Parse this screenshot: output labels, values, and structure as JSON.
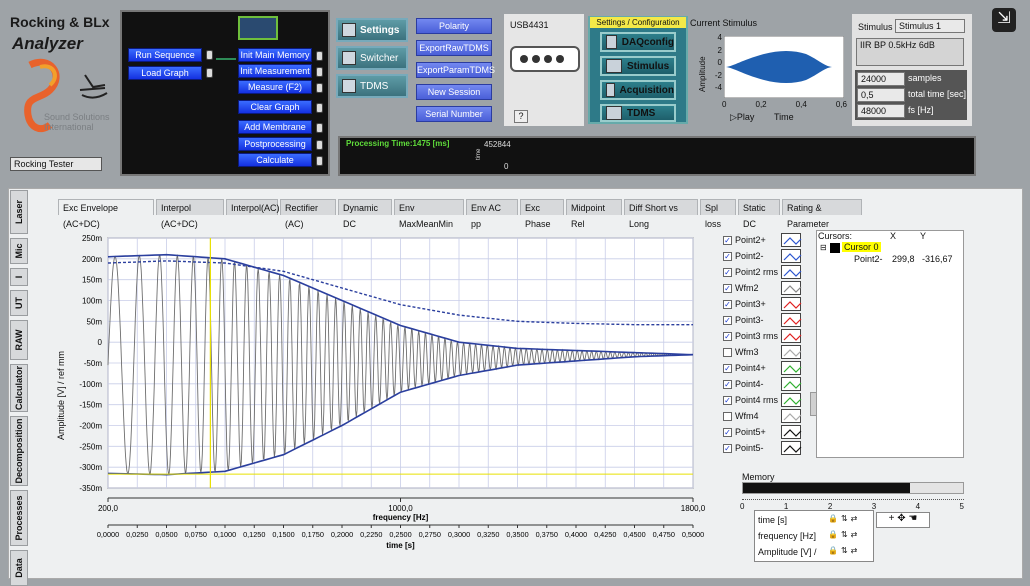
{
  "app": {
    "title_line1": "Rocking & BLx",
    "title_line2": "Analyzer",
    "company_line1": "Sound Solutions",
    "company_line2": "International",
    "tester_name": "Rocking Tester"
  },
  "left_buttons": [
    {
      "label": "Run Sequence"
    },
    {
      "label": "Load Graph"
    }
  ],
  "init_buttons": [
    {
      "label": "Init Main Memory"
    },
    {
      "label": "Init Measurement"
    },
    {
      "label": "Measure (F2)"
    },
    {
      "label": "Clear Graph"
    },
    {
      "label": "Add Membrane"
    },
    {
      "label": "Postprocessing"
    },
    {
      "label": "Calculate"
    }
  ],
  "settings_buttons": [
    {
      "label": "Settings"
    },
    {
      "label": "Switcher"
    },
    {
      "label": "TDMS"
    }
  ],
  "export_buttons": [
    {
      "label": "Polarity"
    },
    {
      "label": "ExportRawTDMS"
    },
    {
      "label": "ExportParamTDMS"
    },
    {
      "label": "New Session"
    },
    {
      "label": "Serial Number"
    }
  ],
  "device": {
    "name": "USB4431",
    "help": "?"
  },
  "config": {
    "title": "Settings / Configuration",
    "buttons": [
      {
        "label": "DAQconfig"
      },
      {
        "label": "Stimulus"
      },
      {
        "label": "Acquisition"
      },
      {
        "label": "TDMS"
      }
    ]
  },
  "stimulus_graph": {
    "title": "Current Stimulus",
    "ylabel": "Amplitude",
    "xlabel": "Time",
    "play_label": "Play",
    "yticks": [
      "4",
      "2",
      "0",
      "-2",
      "-4"
    ],
    "xticks": [
      "0",
      "0,2",
      "0,4",
      "0,6"
    ]
  },
  "stimulus_info": {
    "label": "Stimulus",
    "value": "Stimulus 1",
    "description": "IIR BP 0.5kHz 6dB",
    "params": [
      {
        "value": "24000",
        "unit": "samples"
      },
      {
        "value": "0,5",
        "unit": "total time [sec]"
      },
      {
        "value": "48000",
        "unit": "fs [Hz]"
      }
    ]
  },
  "processing": {
    "label": "Processing Time:1475 [ms]",
    "value_top": "452844",
    "value_bottom": "0",
    "axis_label": "time"
  },
  "tabs": [
    "Exc Envelope (AC+DC)",
    "Interpol (AC+DC)",
    "Interpol(AC)",
    "Rectifier (AC)",
    "Dynamic DC",
    "Env MaxMeanMin",
    "Env AC pp",
    "Exc Phase",
    "Midpoint Rel",
    "Diff Short vs Long",
    "Spl loss",
    "Static DC",
    "Rating & Parameter"
  ],
  "side_tabs": [
    "Laser",
    "Mic",
    "I",
    "UT",
    "RAW",
    "Calculator",
    "Decomposition",
    "Processes",
    "Data"
  ],
  "main_chart": {
    "ylabel": "Amplitude [V] / ref mm",
    "xlabel_top": "frequency [Hz]",
    "xlabel_bottom": "time [s]",
    "yticks": [
      "250m",
      "200m",
      "150m",
      "100m",
      "50m",
      "0",
      "-50m",
      "-100m",
      "-150m",
      "-200m",
      "-250m",
      "-300m",
      "-350m"
    ],
    "freq_ticks": [
      "200,0",
      "1000,0",
      "1800,0"
    ],
    "time_ticks": [
      "0,0000",
      "0,0250",
      "0,0500",
      "0,0750",
      "0,1000",
      "0,1250",
      "0,1500",
      "0,1750",
      "0,2000",
      "0,2250",
      "0,2500",
      "0,2750",
      "0,3000",
      "0,3250",
      "0,3500",
      "0,3750",
      "0,4000",
      "0,4250",
      "0,4500",
      "0,4750",
      "0,5000"
    ],
    "colors": {
      "bg": "#ffffff",
      "fill": "#6e6e6e",
      "envelope": "#2b3f9e",
      "cursor": "#e8e000",
      "grid": "#c8cde8"
    }
  },
  "chart_data": {
    "type": "area",
    "x_unit": "time [s]",
    "y_unit": "Amplitude [V] / ref mm",
    "ylim": [
      -0.35,
      0.25
    ],
    "xlim": [
      0,
      0.5
    ],
    "series": [
      {
        "name": "Point2+",
        "x": [
          0,
          0.05,
          0.1,
          0.15,
          0.2,
          0.25,
          0.3,
          0.35,
          0.4,
          0.45,
          0.5
        ],
        "y": [
          0.205,
          0.21,
          0.2,
          0.16,
          0.1,
          0.04,
          0.0,
          -0.015,
          -0.02,
          -0.025,
          -0.03
        ]
      },
      {
        "name": "Point2-",
        "x": [
          0,
          0.05,
          0.1,
          0.15,
          0.2,
          0.25,
          0.3,
          0.35,
          0.4,
          0.45,
          0.5
        ],
        "y": [
          -0.315,
          -0.318,
          -0.31,
          -0.27,
          -0.2,
          -0.12,
          -0.08,
          -0.055,
          -0.045,
          -0.035,
          -0.03
        ]
      },
      {
        "name": "Point2 rms",
        "x": [
          0,
          0.05,
          0.1,
          0.15,
          0.2,
          0.25,
          0.3,
          0.35,
          0.4,
          0.45,
          0.5
        ],
        "y": [
          0.19,
          0.195,
          0.19,
          0.17,
          0.13,
          0.09,
          0.065,
          0.05,
          0.045,
          0.042,
          0.042
        ]
      }
    ]
  },
  "legend": [
    {
      "name": "Point2+",
      "checked": true,
      "color": "#2b55d0"
    },
    {
      "name": "Point2-",
      "checked": true,
      "color": "#2b55d0"
    },
    {
      "name": "Point2 rms",
      "checked": true,
      "color": "#2b55d0"
    },
    {
      "name": "Wfm2",
      "checked": true,
      "color": "#888888"
    },
    {
      "name": "Point3+",
      "checked": true,
      "color": "#e02020"
    },
    {
      "name": "Point3-",
      "checked": true,
      "color": "#e02020"
    },
    {
      "name": "Point3 rms",
      "checked": true,
      "color": "#e02020"
    },
    {
      "name": "Wfm3",
      "checked": false,
      "color": "#aaaaaa"
    },
    {
      "name": "Point4+",
      "checked": true,
      "color": "#30b030"
    },
    {
      "name": "Point4-",
      "checked": true,
      "color": "#30b030"
    },
    {
      "name": "Point4 rms",
      "checked": true,
      "color": "#30b030"
    },
    {
      "name": "Wfm4",
      "checked": false,
      "color": "#aaaaaa"
    },
    {
      "name": "Point5+",
      "checked": true,
      "color": "#111111"
    },
    {
      "name": "Point5-",
      "checked": true,
      "color": "#111111"
    }
  ],
  "cursors": {
    "headers": [
      "Cursors:",
      "X",
      "Y"
    ],
    "name": "Cursor 0",
    "trace": "Point2-",
    "x": "299,8",
    "y": "-316,67"
  },
  "memory": {
    "label": "Memory",
    "ticks": [
      "0",
      "1",
      "2",
      "3",
      "4",
      "5"
    ],
    "value": 3.8,
    "max": 5
  },
  "axis_table": [
    {
      "label": "time [s]"
    },
    {
      "label": "frequency [Hz]"
    },
    {
      "label": "Amplitude [V] /"
    }
  ]
}
